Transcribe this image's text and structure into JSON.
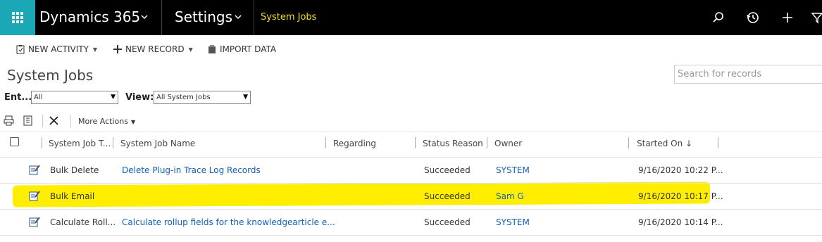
{
  "nav": {
    "app_name": "Dynamics 365",
    "area_name": "Settings",
    "breadcrumb": "System Jobs",
    "colors": {
      "bar": "#000000",
      "waffle": "#1aa7b6",
      "breadcrumb": "#f5e11c"
    }
  },
  "commands": {
    "new_activity": "NEW ACTIVITY",
    "new_record": "NEW RECORD",
    "import_data": "IMPORT DATA"
  },
  "page": {
    "title": "System Jobs",
    "search_placeholder": "Search for records"
  },
  "filters": {
    "entity_label": "Ent...",
    "entity_value": "All",
    "view_label": "View:",
    "view_value": "All System Jobs"
  },
  "toolbar": {
    "more_actions": "More Actions"
  },
  "grid": {
    "columns": [
      "System Job T...",
      "System Job Name",
      "Regarding",
      "Status Reason",
      "Owner",
      "Started On ↓"
    ],
    "rows": [
      {
        "type": "Bulk Delete",
        "name": "Delete Plug-in Trace Log Records",
        "regarding": "",
        "status": "Succeeded",
        "owner": "SYSTEM",
        "started": "9/16/2020 10:22 P..."
      },
      {
        "type": "Bulk Email",
        "name": "",
        "regarding": "",
        "status": "Succeeded",
        "owner": "Sam G",
        "started": "9/16/2020 10:17 P..."
      },
      {
        "type": "Calculate Roll...",
        "name": "Calculate rollup fields for the knowledgearticle e...",
        "regarding": "",
        "status": "Succeeded",
        "owner": "SYSTEM",
        "started": "9/16/2020 10:14 P..."
      }
    ],
    "highlight_color": "#ffee00"
  }
}
